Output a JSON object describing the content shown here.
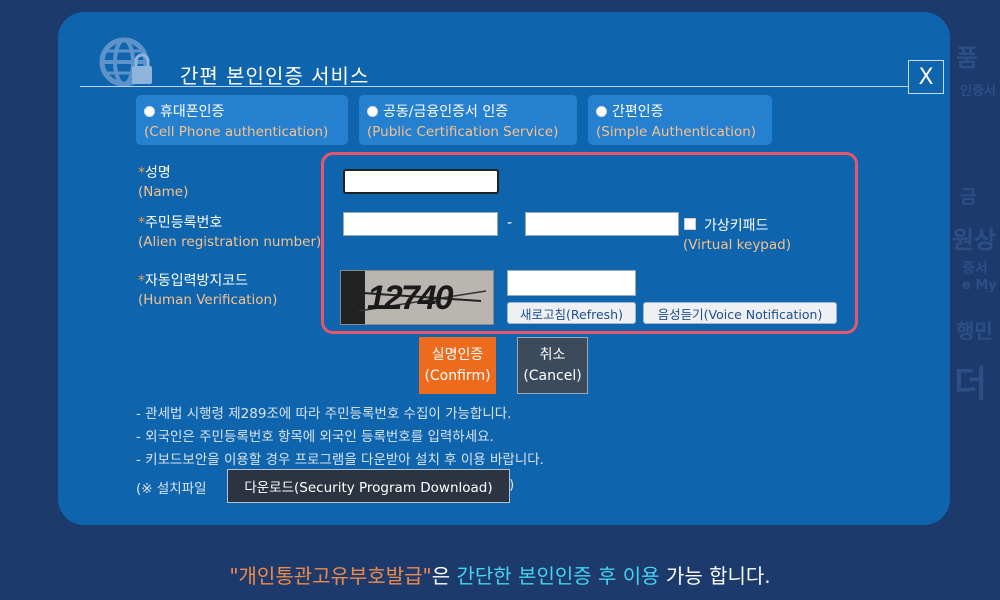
{
  "dialog": {
    "title": "간편 본인인증 서비스",
    "close_label": "X"
  },
  "auth_tabs": [
    {
      "ko": "휴대폰인증",
      "en": "(Cell Phone authentication)"
    },
    {
      "ko": "공동/금융인증서 인증",
      "en": "(Public Certification Service)"
    },
    {
      "ko": "간편인증",
      "en": "(Simple Authentication)"
    }
  ],
  "form": {
    "name_label": {
      "ko": "성명",
      "en": "(Name)"
    },
    "reg_label": {
      "ko": "주민등록번호",
      "en": "(Alien registration number)"
    },
    "captcha_label": {
      "ko": "자동입력방지코드",
      "en": "(Human Verification)"
    },
    "required_mark": "*",
    "separator": "-",
    "virtual_keypad": {
      "ko": "가상키패드",
      "en": "(Virtual keypad)"
    },
    "captcha_code": "12740",
    "refresh_label": "새로고침(Refresh)",
    "voice_label": "음성듣기(Voice Notification)"
  },
  "actions": {
    "confirm": {
      "ko": "실명인증",
      "en": "(Confirm)"
    },
    "cancel": {
      "ko": "취소",
      "en": "(Cancel)"
    }
  },
  "notes": [
    "- 관세법 시행령 제289조에 따라 주민등록번호 수집이 가능합니다.",
    "- 외국인은 주민등록번호 항목에 외국인 등록번호를 입력하세요.",
    "- 키보드보안을 이용할 경우 프로그램을 다운받아 설치 후 이용 바랍니다."
  ],
  "download": {
    "prefix": "(※ 설치파일",
    "button": "다운로드(Security Program Download)",
    "suffix": ")"
  },
  "bottom_message": {
    "part1": "\"개인통관고유부호발급\"",
    "part2": "은 ",
    "part3": "간단한 ",
    "part4": "본인인증 후 이용",
    "part5": " 가능 합니다."
  },
  "background_text": [
    "품",
    "인증서",
    "금",
    "원상",
    "증서",
    "e My",
    "행민",
    "더"
  ],
  "colors": {
    "page_bg": "#1c3a6b",
    "modal_bg": "#0e64ad",
    "accent_orange": "#ee6a1c",
    "highlight": "#e8566a",
    "cyan": "#44d3f0"
  }
}
